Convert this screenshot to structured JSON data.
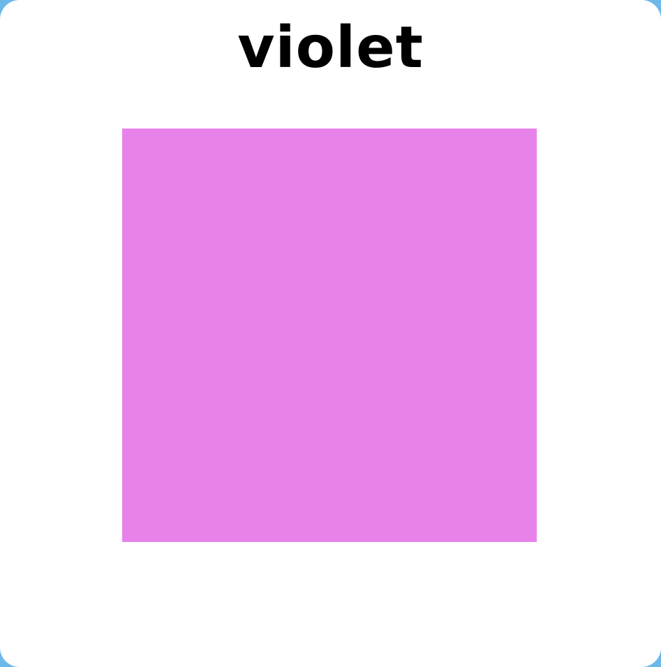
{
  "card": {
    "title": "violet"
  },
  "swatch": {
    "color": "#e882eb"
  }
}
